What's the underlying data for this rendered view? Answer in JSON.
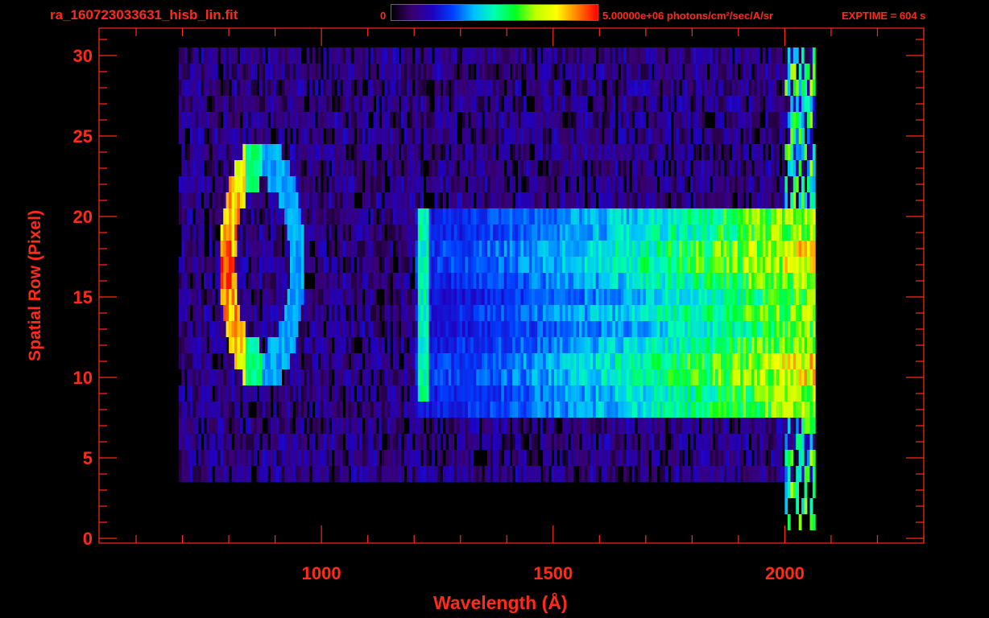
{
  "header": {
    "filename": "ra_160723033631_hisb_lin.fit",
    "colorbar_min": "0",
    "colorbar_max": "5.00000e+06 photons/cm²/sec/A/sr",
    "exptime": "EXPTIME = 604 s"
  },
  "colors": {
    "axis": "#ff2a1a",
    "background": "#000000",
    "colormap": [
      "#000000",
      "#3a0070",
      "#2000c0",
      "#0040ff",
      "#00c0ff",
      "#00ffb0",
      "#00ff20",
      "#c0ff00",
      "#ffff00",
      "#ff8000",
      "#ff0000"
    ]
  },
  "chart_data": {
    "type": "heatmap",
    "title": "ra_160723033631_hisb_lin.fit",
    "xlabel": "Wavelength (Å)",
    "ylabel": "Spatial Row (Pixel)",
    "xlim": [
      520,
      2300
    ],
    "ylim": [
      -0.3,
      31.7
    ],
    "xticks": [
      1000,
      1500,
      2000
    ],
    "xtick_labels": [
      "1000",
      "1500",
      "2000"
    ],
    "xminor_step": 100,
    "yticks": [
      0,
      5,
      10,
      15,
      20,
      25,
      30
    ],
    "ytick_labels": [
      "0",
      "5",
      "10",
      "15",
      "20",
      "25",
      "30"
    ],
    "yminor_step": 1,
    "colorbar_range": [
      0,
      5000000
    ],
    "colorbar_units": "photons/cm²/sec/A/sr",
    "grid": false,
    "features": [
      {
        "kind": "background_band",
        "rows": [
          4,
          30
        ],
        "wavelength": [
          690,
          2060
        ],
        "relative_level": 0.12
      },
      {
        "kind": "slit_band",
        "rows": [
          8,
          20
        ],
        "wavelength": [
          1200,
          2060
        ],
        "relative_level_start": 0.25,
        "relative_level_end": 0.72
      },
      {
        "kind": "emission_line_ring",
        "center_wavelength": 870,
        "center_row": 17,
        "semi_axis_wavelength": 75,
        "semi_axis_rows": 6.5,
        "peak_level": 0.95
      },
      {
        "kind": "emission_line",
        "wavelength": 1216,
        "rows": [
          9,
          20
        ],
        "relative_level": 0.5
      },
      {
        "kind": "detector_edge",
        "wavelength": [
          2000,
          2065
        ],
        "rows": [
          1,
          30
        ],
        "relative_level": 0.55
      }
    ]
  }
}
